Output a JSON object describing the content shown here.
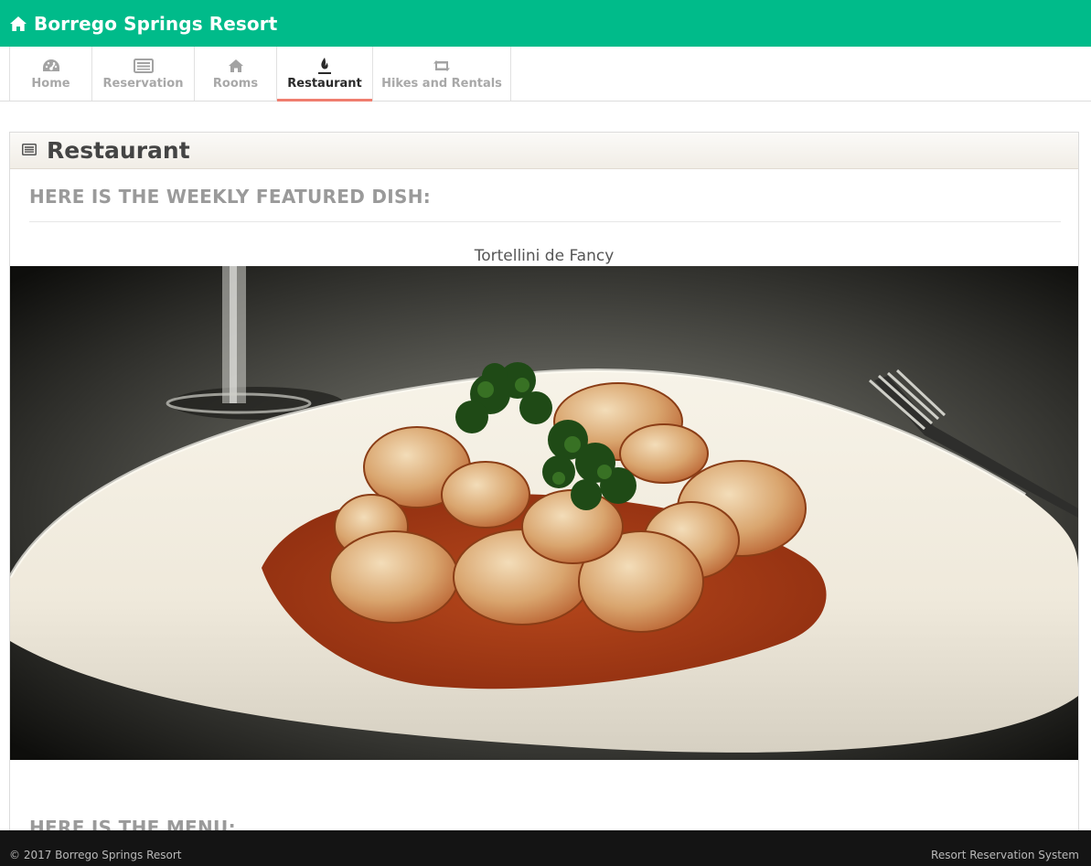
{
  "header": {
    "title": "Borrego Springs Resort",
    "icon": "home-icon"
  },
  "nav": {
    "tabs": [
      {
        "label": "Home",
        "icon": "dashboard-icon"
      },
      {
        "label": "Reservation",
        "icon": "list-icon"
      },
      {
        "label": "Rooms",
        "icon": "home-icon"
      },
      {
        "label": "Restaurant",
        "icon": "fire-icon",
        "active": true
      },
      {
        "label": "Hikes and Rentals",
        "icon": "retweet-icon"
      }
    ]
  },
  "panel": {
    "title": "Restaurant",
    "icon": "list-icon",
    "featured_heading": "HERE IS THE WEEKLY FEATURED DISH:",
    "dish_name": "Tortellini de Fancy",
    "menu_heading": "HERE IS THE MENU:"
  },
  "footer": {
    "copyright": "© 2017 Borrego Springs Resort",
    "system_name": "Resort Reservation System"
  },
  "colors": {
    "brand": "#00bb8a",
    "active_tab_underline": "#ef7d6e",
    "footer_bg": "#141414"
  }
}
